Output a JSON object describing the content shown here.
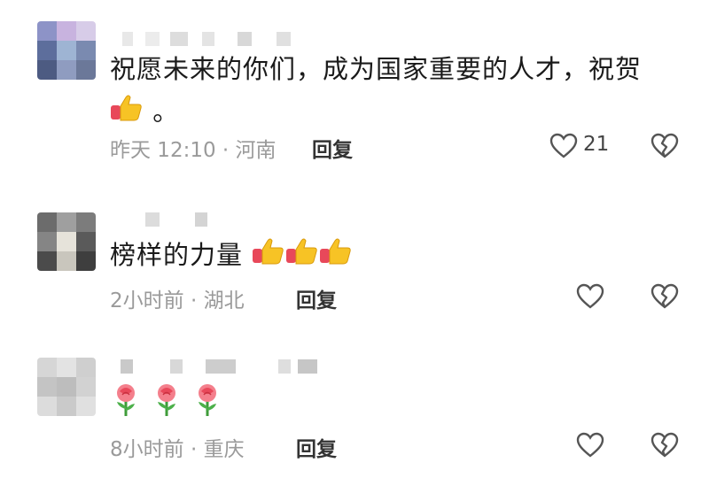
{
  "comments": [
    {
      "text": "祝愿未来的你们，成为国家重要的人才，祝贺",
      "text_tail": "。",
      "emoji": [
        "thumbs-up"
      ],
      "time": "昨天 12:10",
      "location": "河南",
      "reply_label": "回复",
      "like_count": "21"
    },
    {
      "text": "榜样的力量",
      "emoji": [
        "thumbs-up",
        "thumbs-up",
        "thumbs-up"
      ],
      "time": "2小时前",
      "location": "湖北",
      "reply_label": "回复",
      "like_count": ""
    },
    {
      "text": "",
      "emoji": [
        "rose",
        "rose",
        "rose"
      ],
      "time": "8小时前",
      "location": "重庆",
      "reply_label": "回复",
      "like_count": ""
    }
  ],
  "separator": " · ",
  "colors": {
    "meta": "#9a9a9a",
    "text": "#1a1a1a",
    "icon": "#555555"
  },
  "icons": {
    "like": "heart-outline-icon",
    "dislike": "broken-heart-icon",
    "thumbs": "thumbs-up-emoji",
    "rose": "rose-emoji"
  }
}
